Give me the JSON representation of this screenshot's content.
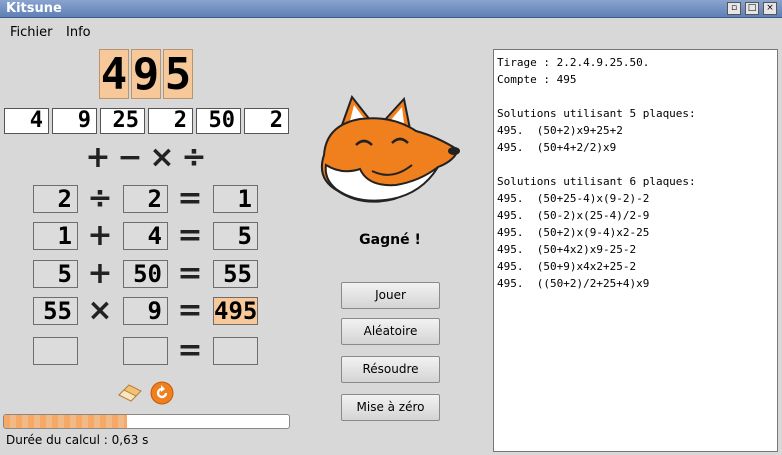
{
  "window": {
    "title": "Kitsune"
  },
  "menu": {
    "items": [
      "Fichier",
      "Info"
    ]
  },
  "target": {
    "digits": [
      "4",
      "9",
      "5"
    ]
  },
  "plates": [
    "4",
    "9",
    "25",
    "2",
    "50",
    "2"
  ],
  "operators": {
    "plus": "+",
    "minus": "−",
    "times": "×",
    "divide": "÷"
  },
  "steps": [
    {
      "a": "2",
      "op": "÷",
      "b": "2",
      "eq": "=",
      "r": "1",
      "highlight": false
    },
    {
      "a": "1",
      "op": "+",
      "b": "4",
      "eq": "=",
      "r": "5",
      "highlight": false
    },
    {
      "a": "5",
      "op": "+",
      "b": "50",
      "eq": "=",
      "r": "55",
      "highlight": false
    },
    {
      "a": "55",
      "op": "×",
      "b": "9",
      "eq": "=",
      "r": "495",
      "highlight": true
    },
    {
      "a": "",
      "op": "",
      "b": "",
      "eq": "=",
      "r": "",
      "highlight": false
    }
  ],
  "result_message": "Gagné !",
  "buttons": {
    "play": "Jouer",
    "random": "Aléatoire",
    "solve": "Résoudre",
    "reset": "Mise à zéro"
  },
  "icons": {
    "eraser": "eraser-icon",
    "undo": "undo-icon",
    "fox": "fox-mascot"
  },
  "progress": {
    "fraction": 0.43
  },
  "status": {
    "duration_text": "Durée du calcul : 0,63 s"
  },
  "solutions_panel": {
    "lines": [
      "Tirage : 2.2.4.9.25.50.",
      "Compte : 495",
      "",
      "Solutions utilisant 5 plaques:",
      "495.  (50+2)x9+25+2",
      "495.  (50+4+2/2)x9",
      "",
      "Solutions utilisant 6 plaques:",
      "495.  (50+25-4)x(9-2)-2",
      "495.  (50-2)x(25-4)/2-9",
      "495.  (50+2)x(9-4)x2-25",
      "495.  (50+4x2)x9-25-2",
      "495.  (50+9)x4x2+25-2",
      "495.  ((50+2)/2+25+4)x9"
    ]
  },
  "colors": {
    "accent": "#f7c89a",
    "fox_orange": "#f07f1e",
    "progress": "#f6a867"
  }
}
